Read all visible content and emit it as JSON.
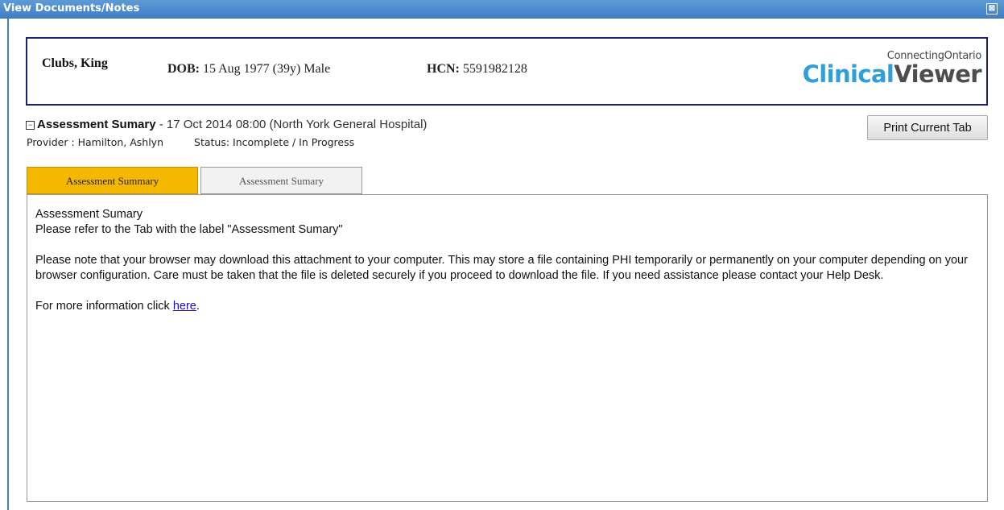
{
  "window": {
    "title": "View Documents/Notes",
    "close_symbol": "⊠"
  },
  "patient": {
    "name": "Clubs, King",
    "dob_label": "DOB:",
    "dob_value": "15 Aug 1977 (39y) Male",
    "hcn_label": "HCN:",
    "hcn_value": "5591982128"
  },
  "brand": {
    "top_line": "ConnectingOntario",
    "word1": "Clinical",
    "word2": "Viewer"
  },
  "document": {
    "collapse_symbol": "−",
    "title": "Assessment Sumary",
    "details": " - 17 Oct 2014 08:00 (North York General Hospital)",
    "provider": "Provider : Hamilton, Ashlyn",
    "status": "Status: Incomplete / In Progress"
  },
  "toolbar": {
    "print_label": "Print Current Tab"
  },
  "tabs": [
    {
      "label": "Assessment Summary"
    },
    {
      "label": "Assessment Sumary"
    }
  ],
  "content": {
    "line1": "Assessment Sumary",
    "line2": "Please refer to the Tab with the label \"Assessment Sumary\"",
    "notice": "Please note that your browser may download this attachment to your computer. This may store a file containing PHI temporarily or permanently on your computer depending on your browser configuration. Care must be taken that the file is deleted securely if you proceed to download the file. If you need assistance please contact your Help Desk.",
    "more_info_prefix": "For more information click ",
    "more_info_link": "here",
    "more_info_suffix": "."
  },
  "colors": {
    "titlebar": "#3f7fc4",
    "active_tab": "#f5b800",
    "banner_border": "#1d1f6b",
    "brand_blue": "#2e9fda"
  }
}
